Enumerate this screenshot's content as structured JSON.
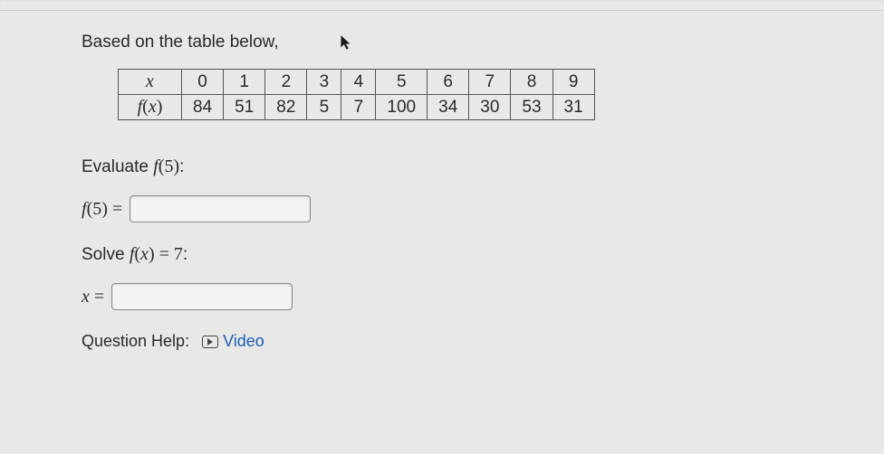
{
  "intro": "Based on the table below,",
  "table": {
    "header_x": "x",
    "header_fx": "f(x)",
    "x_values": [
      "0",
      "1",
      "2",
      "3",
      "4",
      "5",
      "6",
      "7",
      "8",
      "9"
    ],
    "fx_values": [
      "84",
      "51",
      "82",
      "5",
      "7",
      "100",
      "34",
      "30",
      "53",
      "31"
    ]
  },
  "evaluate": {
    "prompt_prefix": "Evaluate ",
    "prompt_fn": "f(5)",
    "prompt_suffix": ":",
    "label": "f(5) =",
    "value": ""
  },
  "solve": {
    "prompt_prefix": "Solve ",
    "prompt_fn": "f(x) = 7",
    "prompt_suffix": ":",
    "label": "x =",
    "value": ""
  },
  "help": {
    "label": "Question Help:",
    "video": "Video"
  }
}
